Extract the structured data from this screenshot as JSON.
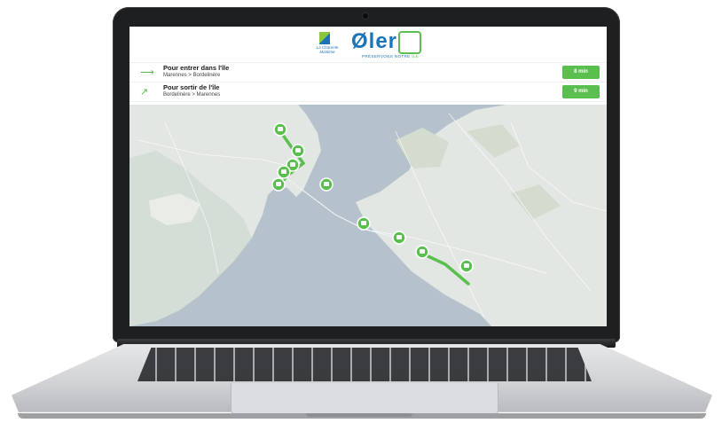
{
  "header": {
    "partner_logo_text": "La Charente Maritime",
    "brand_text": "Øler",
    "tagline_main": "PRÉSERVONS NOTRE",
    "tagline_accent": "ÎLE"
  },
  "routes": [
    {
      "title": "Pour entrer dans l'île",
      "subtitle": "Marennes > Bordelinère",
      "time": "8 min",
      "icon": "arrow-right-icon"
    },
    {
      "title": "Pour sortir de l'île",
      "subtitle": "Bordelinère > Marennes",
      "time": "9 min",
      "icon": "trend-up-icon"
    }
  ],
  "colors": {
    "accent_green": "#5bbf4f",
    "brand_blue": "#1b73b8",
    "water": "#b5c2cc",
    "land": "#e3e7e4"
  }
}
